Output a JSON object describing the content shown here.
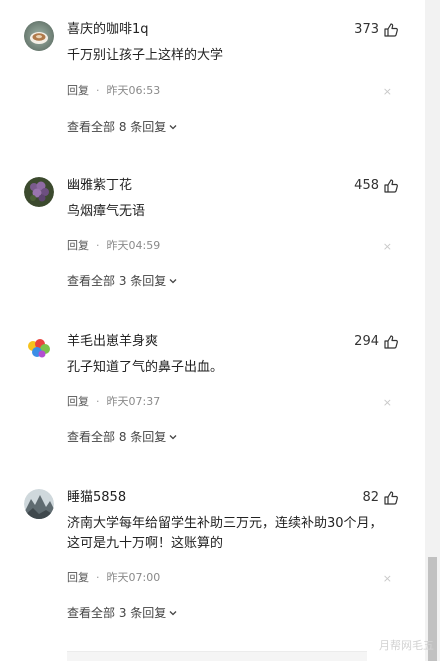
{
  "comments": [
    {
      "username": "喜庆的咖啡1q",
      "likes": "373",
      "text": "千万别让孩子上这样的大学",
      "reply_label": "回复",
      "dot": "·",
      "time": "昨天06:53",
      "view_replies": "查看全部 8 条回复",
      "avatar_icon": "coffee-cup-avatar"
    },
    {
      "username": "幽雅紫丁花",
      "likes": "458",
      "text": "鸟烟瘴气无语",
      "reply_label": "回复",
      "dot": "·",
      "time": "昨天04:59",
      "view_replies": "查看全部 3 条回复",
      "avatar_icon": "lilac-flower-avatar"
    },
    {
      "username": "羊毛出崽羊身爽",
      "likes": "294",
      "text": "孔子知道了气的鼻子出血。",
      "reply_label": "回复",
      "dot": "·",
      "time": "昨天07:37",
      "view_replies": "查看全部 8 条回复",
      "avatar_icon": "colorful-balloons-avatar"
    },
    {
      "username": "睡猫5858",
      "likes": "82",
      "text": "济南大学每年给留学生补助三万元，连续补助30个月，这可是九十万啊！这账算的",
      "reply_label": "回复",
      "dot": "·",
      "time": "昨天07:00",
      "view_replies": "查看全部 3 条回复",
      "avatar_icon": "mountain-landscape-avatar"
    }
  ],
  "close_glyph": "×",
  "watermark": "月帮网毛五",
  "colors": {
    "text": "#222222",
    "muted": "#8a8a8a",
    "scrollbar_track": "#f2f2f2",
    "scrollbar_thumb": "#c1c1c1"
  }
}
